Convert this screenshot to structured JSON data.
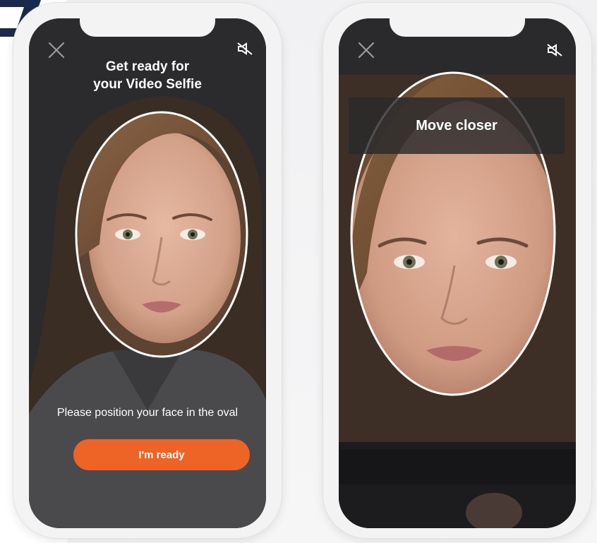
{
  "colors": {
    "accent": "#ee6326",
    "screen_bg": "#2b2b2d",
    "logo": "#1b2a4a"
  },
  "icons": {
    "close": "close-icon",
    "sound_off": "speaker-muted-icon",
    "logo": "logo-mark-icon"
  },
  "screen1": {
    "title_line1": "Get ready for",
    "title_line2": "your Video Selfie",
    "instruction": "Please position your face in the oval",
    "button_label": "I'm ready"
  },
  "screen2": {
    "banner": "Move closer"
  }
}
